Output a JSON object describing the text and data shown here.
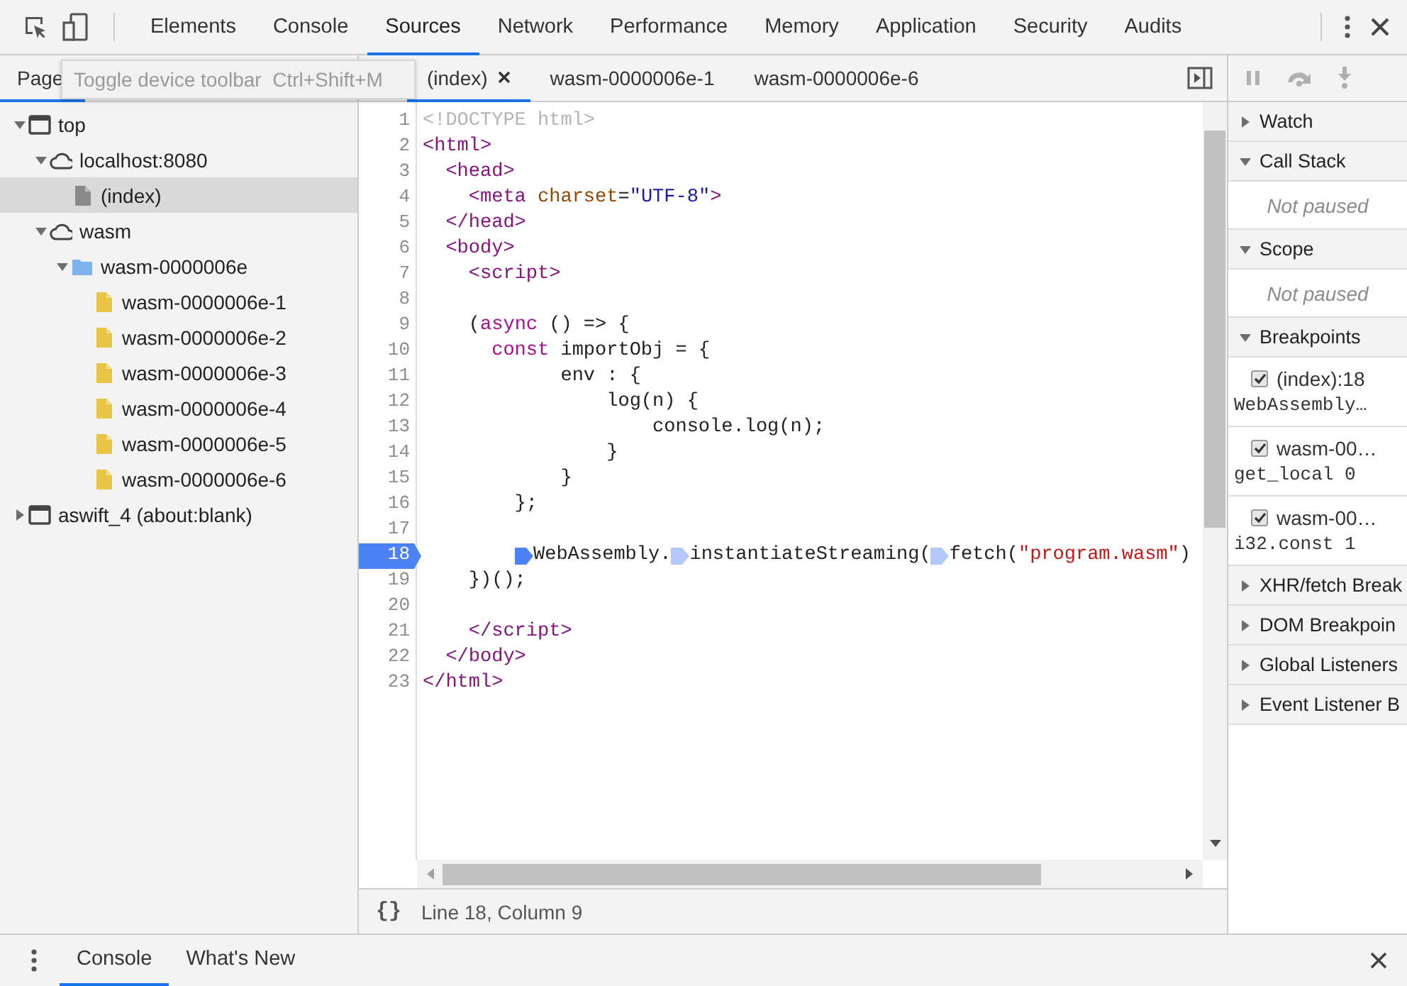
{
  "main_tabs": [
    {
      "label": "Elements",
      "selected": false
    },
    {
      "label": "Console",
      "selected": false
    },
    {
      "label": "Sources",
      "selected": true
    },
    {
      "label": "Network",
      "selected": false
    },
    {
      "label": "Performance",
      "selected": false
    },
    {
      "label": "Memory",
      "selected": false
    },
    {
      "label": "Application",
      "selected": false
    },
    {
      "label": "Security",
      "selected": false
    },
    {
      "label": "Audits",
      "selected": false
    }
  ],
  "navigator": {
    "tabs": [
      {
        "label": "Page",
        "selected": true
      }
    ],
    "tooltip": "Toggle device toolbar  Ctrl+Shift+M",
    "tree": [
      {
        "label": "top",
        "kind": "frame",
        "expanded": true,
        "selected": false,
        "children": [
          {
            "label": "localhost:8080",
            "kind": "domain",
            "expanded": true,
            "selected": false,
            "children": [
              {
                "label": "(index)",
                "kind": "document",
                "selected": true
              }
            ]
          },
          {
            "label": "wasm",
            "kind": "domain",
            "expanded": true,
            "selected": false,
            "children": [
              {
                "label": "wasm-0000006e",
                "kind": "folder",
                "expanded": true,
                "selected": false,
                "children": [
                  {
                    "label": "wasm-0000006e-1",
                    "kind": "script",
                    "selected": false
                  },
                  {
                    "label": "wasm-0000006e-2",
                    "kind": "script",
                    "selected": false
                  },
                  {
                    "label": "wasm-0000006e-3",
                    "kind": "script",
                    "selected": false
                  },
                  {
                    "label": "wasm-0000006e-4",
                    "kind": "script",
                    "selected": false
                  },
                  {
                    "label": "wasm-0000006e-5",
                    "kind": "script",
                    "selected": false
                  },
                  {
                    "label": "wasm-0000006e-6",
                    "kind": "script",
                    "selected": false
                  }
                ]
              }
            ]
          }
        ]
      },
      {
        "label": "aswift_4 (about:blank)",
        "kind": "frame",
        "expanded": false,
        "selected": false
      }
    ]
  },
  "editor": {
    "tabs": [
      {
        "label": "(index)",
        "selected": true
      },
      {
        "label": "wasm-0000006e-1",
        "selected": false
      },
      {
        "label": "wasm-0000006e-6",
        "selected": false
      }
    ],
    "lines": [
      {
        "number": "1",
        "breakpoint": false,
        "segments": [
          {
            "kind": "doctype",
            "text": "<!DOCTYPE html>"
          }
        ]
      },
      {
        "number": "2",
        "breakpoint": false,
        "segments": [
          {
            "kind": "tag",
            "text": "<html>"
          }
        ]
      },
      {
        "number": "3",
        "breakpoint": false,
        "segments": [
          {
            "kind": "tag",
            "text": "  <head>"
          }
        ]
      },
      {
        "number": "4",
        "breakpoint": false,
        "segments": [
          {
            "kind": "tag",
            "text": "    <meta "
          },
          {
            "kind": "attr",
            "text": "charset"
          },
          {
            "kind": "plain",
            "text": "="
          },
          {
            "kind": "attr-value",
            "text": "\"UTF-8\""
          },
          {
            "kind": "tag",
            "text": ">"
          }
        ]
      },
      {
        "number": "5",
        "breakpoint": false,
        "segments": [
          {
            "kind": "tag",
            "text": "  </head>"
          }
        ]
      },
      {
        "number": "6",
        "breakpoint": false,
        "segments": [
          {
            "kind": "tag",
            "text": "  <body>"
          }
        ]
      },
      {
        "number": "7",
        "breakpoint": false,
        "segments": [
          {
            "kind": "tag",
            "text": "    <script>"
          }
        ]
      },
      {
        "number": "8",
        "breakpoint": false
      },
      {
        "number": "9",
        "breakpoint": false,
        "segments": [
          {
            "kind": "plain",
            "text": "    ("
          },
          {
            "kind": "keyword",
            "text": "async"
          },
          {
            "kind": "plain",
            "text": " () => {"
          }
        ]
      },
      {
        "number": "10",
        "breakpoint": false,
        "segments": [
          {
            "kind": "keyword",
            "text": "      const"
          },
          {
            "kind": "plain",
            "text": " importObj = {"
          }
        ]
      },
      {
        "number": "11",
        "breakpoint": false,
        "segments": [
          {
            "kind": "plain",
            "text": "            env : {"
          }
        ]
      },
      {
        "number": "12",
        "breakpoint": false,
        "segments": [
          {
            "kind": "plain",
            "text": "                log(n) {"
          }
        ]
      },
      {
        "number": "13",
        "breakpoint": false,
        "segments": [
          {
            "kind": "plain",
            "text": "                    console.log(n);"
          }
        ]
      },
      {
        "number": "14",
        "breakpoint": false,
        "segments": [
          {
            "kind": "plain",
            "text": "                }"
          }
        ]
      },
      {
        "number": "15",
        "breakpoint": false,
        "segments": [
          {
            "kind": "plain",
            "text": "            }"
          }
        ]
      },
      {
        "number": "16",
        "breakpoint": false,
        "segments": [
          {
            "kind": "plain",
            "text": "        };"
          }
        ]
      },
      {
        "number": "17",
        "breakpoint": false
      },
      {
        "number": "18",
        "breakpoint": true,
        "segments": [
          {
            "kind": "marker",
            "active": true
          },
          {
            "kind": "plain",
            "text": "WebAssembly."
          },
          {
            "kind": "marker",
            "active": false
          },
          {
            "kind": "plain",
            "text": "instantiateStreaming("
          },
          {
            "kind": "marker",
            "active": false
          },
          {
            "kind": "plain",
            "text": "fetch("
          },
          {
            "kind": "string",
            "text": "\"program.wasm\""
          },
          {
            "kind": "plain",
            "text": ")"
          }
        ]
      },
      {
        "number": "19",
        "breakpoint": false,
        "segments": [
          {
            "kind": "plain",
            "text": "    })();"
          }
        ]
      },
      {
        "number": "20",
        "breakpoint": false
      },
      {
        "number": "21",
        "breakpoint": false,
        "segments": [
          {
            "kind": "tag",
            "text": "    </script>"
          }
        ]
      },
      {
        "number": "22",
        "breakpoint": false,
        "segments": [
          {
            "kind": "tag",
            "text": "  </body>"
          }
        ]
      },
      {
        "number": "23",
        "breakpoint": false,
        "segments": [
          {
            "kind": "tag",
            "text": "</html>"
          }
        ]
      }
    ],
    "status": {
      "format_icon": "{}",
      "position": "Line 18, Column 9"
    }
  },
  "debugger": {
    "sections": [
      {
        "title": "Watch",
        "expanded": false
      },
      {
        "title": "Call Stack",
        "expanded": true,
        "message": "Not paused"
      },
      {
        "title": "Scope",
        "expanded": true,
        "message": "Not paused"
      },
      {
        "title": "Breakpoints",
        "expanded": true,
        "breakpoints": [
          {
            "label": "(index):18",
            "code": "WebAssembly…",
            "checked": true
          },
          {
            "label": "wasm-00…",
            "code": "get_local 0",
            "checked": true
          },
          {
            "label": "wasm-00…",
            "code": "i32.const 1",
            "checked": true
          }
        ]
      },
      {
        "title": "XHR/fetch Break",
        "expanded": false
      },
      {
        "title": "DOM Breakpoin",
        "expanded": false
      },
      {
        "title": "Global Listeners",
        "expanded": false
      },
      {
        "title": "Event Listener B",
        "expanded": false
      }
    ]
  },
  "drawer": {
    "tabs": [
      {
        "label": "Console",
        "selected": true
      },
      {
        "label": "What's New",
        "selected": false
      }
    ]
  }
}
